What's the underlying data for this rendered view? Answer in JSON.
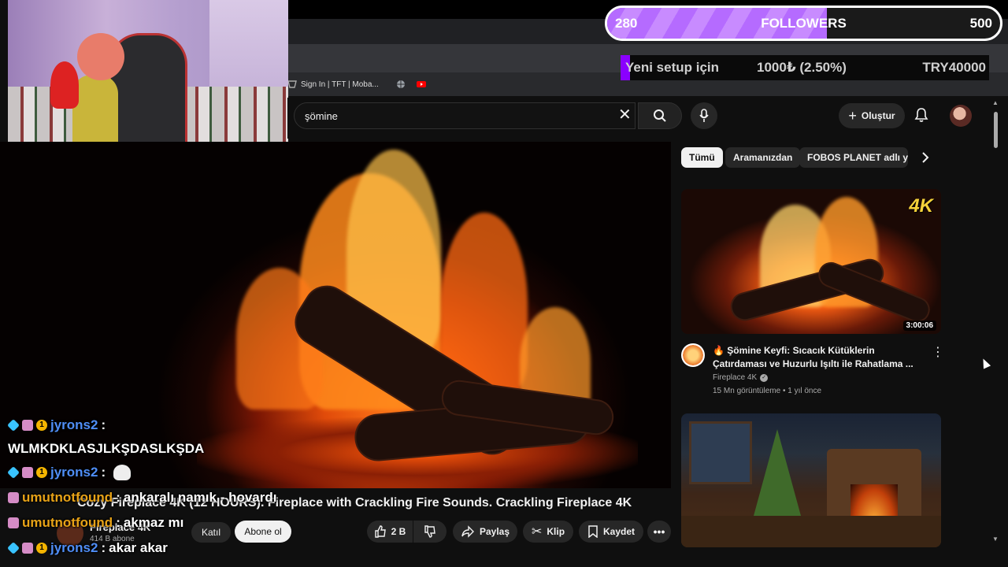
{
  "browser": {
    "bookmarks": [
      {
        "label": "Sign In | TFT | Moba...",
        "icon": "tft-icon"
      },
      {
        "label": "",
        "icon": "globe-icon"
      },
      {
        "label": "",
        "icon": "youtube-icon"
      }
    ]
  },
  "overlay": {
    "followers": {
      "current": "280",
      "label": "FOLLOWERS",
      "goal": "500",
      "progress": 0.56,
      "color": "#b56bff"
    },
    "donation_goal": {
      "label": "Yeni setup için",
      "amount": "1000₺ (2.50%)",
      "target": "TRY40000",
      "progress": 0.025,
      "color": "#8a00ff"
    }
  },
  "search": {
    "value": "şömine"
  },
  "header": {
    "create_label": "Oluştur"
  },
  "chat": [
    {
      "user": "jyrons2",
      "sep": " :",
      "msg": "",
      "color": "#4f8ef7",
      "badges": [
        "blue",
        "pink",
        "gold"
      ]
    },
    {
      "user": "",
      "sep": "",
      "msg": "WLMKDKLASJLKŞDASLKŞDA",
      "color": "#ffffff",
      "badges": []
    },
    {
      "user": "jyrons2",
      "sep": " :",
      "msg": "",
      "color": "#4f8ef7",
      "badges": [
        "blue",
        "pink",
        "gold"
      ],
      "emote": true
    },
    {
      "user": "umutnotfound",
      "sep": " :",
      "msg": " ankaralı namık - hovardı",
      "color": "#e8a317",
      "badges": [
        "pink"
      ]
    },
    {
      "user": "umutnotfound",
      "sep": " :",
      "msg": " akmaz mı",
      "color": "#e8a317",
      "badges": [
        "pink"
      ]
    },
    {
      "user": "jyrons2",
      "sep": " :",
      "msg": " akar akar",
      "color": "#4f8ef7",
      "badges": [
        "blue",
        "pink",
        "gold"
      ]
    }
  ],
  "video": {
    "title": "Cozy Fireplace 4K (12 HOURS). Fireplace with Crackling Fire Sounds. Crackling Fireplace 4K",
    "channel": "Fireplace 4K",
    "subscribers": "414 B abone",
    "join_label": "Katıl",
    "subscribe_label": "Abone ol",
    "likes": "2 B",
    "share_label": "Paylaş",
    "clip_label": "Klip",
    "save_label": "Kaydet"
  },
  "chips": [
    "Tümü",
    "Aramanızdan",
    "FOBOS PLANET adlı yük"
  ],
  "recommendations": [
    {
      "badge": "4K",
      "duration": "3:00:06",
      "title": "🔥 Şömine Keyfi: Sıcacık Kütüklerin Çatırdaması ve Huzurlu Işıltı ile Rahatlama ...",
      "channel": "Fireplace 4K",
      "views": "15 Mn görüntüleme",
      "age": "1 yıl önce"
    },
    {
      "badge": "",
      "duration": "",
      "title": "",
      "channel": "",
      "views": "",
      "age": ""
    }
  ]
}
